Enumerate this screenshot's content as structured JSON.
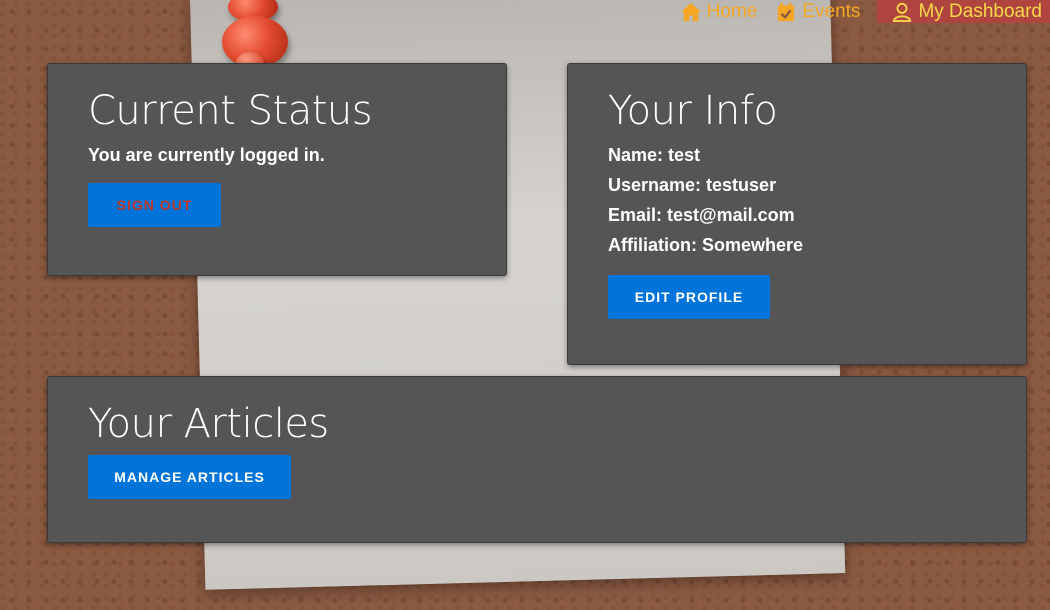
{
  "nav": {
    "items": [
      {
        "label": "Home",
        "icon": "home-icon"
      },
      {
        "label": "Events",
        "icon": "calendar-check-icon"
      },
      {
        "label": "My Dashboard",
        "icon": "user-icon",
        "active": true
      }
    ],
    "color": "#f5a623",
    "active_bg": "#b04540",
    "active_color": "#f5d84a"
  },
  "status": {
    "title": "Current Status",
    "message": "You are currently logged in.",
    "signout_label": "SIGN OUT"
  },
  "info": {
    "title": "Your Info",
    "name": "Name: test",
    "username": "Username: testuser",
    "email": "Email: test@mail.com",
    "affiliation": "Affiliation: Somewhere",
    "edit_label": "EDIT PROFILE"
  },
  "articles": {
    "title": "Your Articles",
    "manage_label": "MANAGE ARTICLES"
  },
  "colors": {
    "card_bg": "#555555",
    "button_bg": "#0074d9",
    "signout_text": "#c0392b"
  }
}
